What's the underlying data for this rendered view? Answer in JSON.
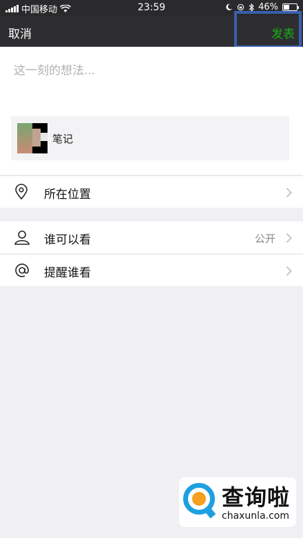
{
  "status_bar": {
    "carrier": "中国移动",
    "time": "23:59",
    "battery": "46%",
    "battery_level": 0.46
  },
  "nav": {
    "cancel_label": "取消",
    "post_label": "发表"
  },
  "compose": {
    "placeholder": "这一刻的想法..."
  },
  "link_card": {
    "title": "笔记"
  },
  "cells": {
    "location": {
      "label": "所在位置",
      "icon": "location-pin-icon"
    },
    "visibility": {
      "label": "谁可以看",
      "value": "公开",
      "icon": "person-icon"
    },
    "remind": {
      "label": "提醒谁看",
      "icon": "at-icon"
    }
  },
  "watermark": {
    "name": "查询啦",
    "url": "chaxunla.com"
  },
  "colors": {
    "post_green": "#1aad19",
    "nav_bg": "#2e2e30",
    "highlight_box": "#3a5fb0"
  }
}
